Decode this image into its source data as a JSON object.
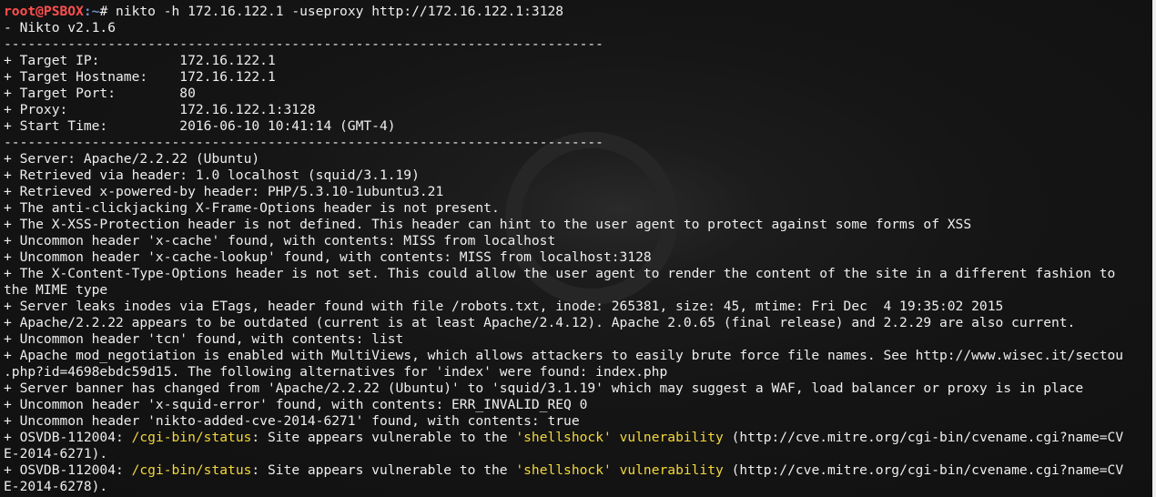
{
  "terminal": {
    "prompt": {
      "user_host": "root@PSBOX",
      "path": ":~",
      "symbol": "# ",
      "command": "nikto -h 172.16.122.1 -useproxy http://172.16.122.1:3128"
    },
    "lines": [
      "- Nikto v2.1.6",
      "---------------------------------------------------------------------------",
      "+ Target IP:          172.16.122.1",
      "+ Target Hostname:    172.16.122.1",
      "+ Target Port:        80",
      "+ Proxy:              172.16.122.1:3128",
      "+ Start Time:         2016-06-10 10:41:14 (GMT-4)",
      "---------------------------------------------------------------------------",
      "+ Server: Apache/2.2.22 (Ubuntu)",
      "+ Retrieved via header: 1.0 localhost (squid/3.1.19)",
      "+ Retrieved x-powered-by header: PHP/5.3.10-1ubuntu3.21",
      "+ The anti-clickjacking X-Frame-Options header is not present.",
      "+ The X-XSS-Protection header is not defined. This header can hint to the user agent to protect against some forms of XSS",
      "+ Uncommon header 'x-cache' found, with contents: MISS from localhost",
      "+ Uncommon header 'x-cache-lookup' found, with contents: MISS from localhost:3128",
      "+ The X-Content-Type-Options header is not set. This could allow the user agent to render the content of the site in a different fashion to",
      "the MIME type",
      "+ Server leaks inodes via ETags, header found with file /robots.txt, inode: 265381, size: 45, mtime: Fri Dec  4 19:35:02 2015",
      "+ Apache/2.2.22 appears to be outdated (current is at least Apache/2.4.12). Apache 2.0.65 (final release) and 2.2.29 are also current.",
      "+ Uncommon header 'tcn' found, with contents: list",
      "+ Apache mod_negotiation is enabled with MultiViews, which allows attackers to easily brute force file names. See http://www.wisec.it/sectou",
      ".php?id=4698ebdc59d15. The following alternatives for 'index' were found: index.php",
      "+ Server banner has changed from 'Apache/2.2.22 (Ubuntu)' to 'squid/3.1.19' which may suggest a WAF, load balancer or proxy is in place",
      "+ Uncommon header 'x-squid-error' found, with contents: ERR_INVALID_REQ 0",
      "+ Uncommon header 'nikto-added-cve-2014-6271' found, with contents: true"
    ],
    "osvdb": [
      {
        "prefix": "+ OSVDB-112004: ",
        "path": "/cgi-bin/status",
        "mid": ": Site appears vulnerable to the ",
        "keyword": "'shellshock' vulnerability",
        "tail": " (http://cve.mitre.org/cgi-bin/cvename.cgi?name=CV",
        "wrap": "E-2014-6271)."
      },
      {
        "prefix": "+ OSVDB-112004: ",
        "path": "/cgi-bin/status",
        "mid": ": Site appears vulnerable to the ",
        "keyword": "'shellshock' vulnerability",
        "tail": " (http://cve.mitre.org/cgi-bin/cvename.cgi?name=CV",
        "wrap": "E-2014-6278)."
      }
    ]
  },
  "colors": {
    "text": "#eeeeee",
    "prompt_user": "#ff4f4f",
    "prompt_path": "#6f8ec8",
    "highlight": "#f3d83a",
    "background": "#141414"
  }
}
